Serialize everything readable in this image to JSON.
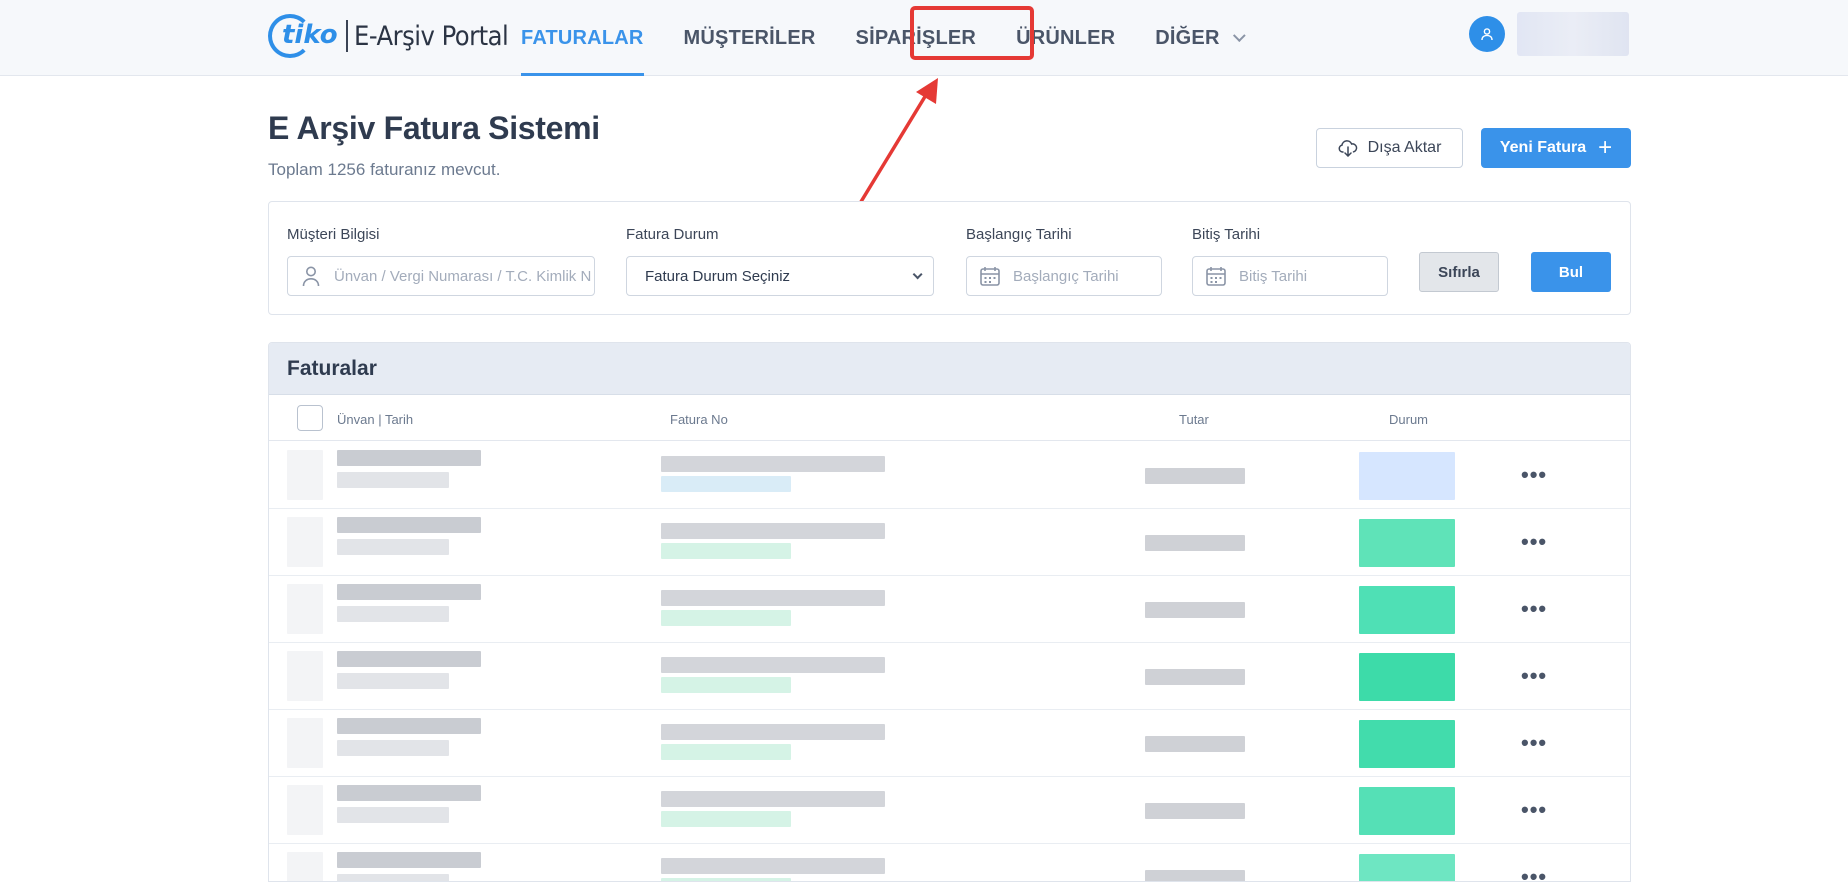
{
  "brand": {
    "logo_text": "tiko",
    "portal_name": "E-Arşiv Portal"
  },
  "nav": {
    "items": [
      {
        "label": "FATURALAR",
        "active": true
      },
      {
        "label": "MÜŞTERİLER",
        "active": false
      },
      {
        "label": "SİPARİŞLER",
        "active": false
      },
      {
        "label": "ÜRÜNLER",
        "active": false,
        "highlighted": true
      },
      {
        "label": "DİĞER",
        "active": false,
        "has_dropdown": true
      }
    ]
  },
  "header": {
    "title": "E Arşiv Fatura Sistemi",
    "subtitle": "Toplam 1256 faturanız mevcut.",
    "export_label": "Dışa Aktar",
    "new_invoice_label": "Yeni Fatura"
  },
  "filters": {
    "customer_label": "Müşteri Bilgisi",
    "customer_placeholder": "Ünvan / Vergi Numarası / T.C. Kimlik N",
    "status_label": "Fatura Durum",
    "status_value": "Fatura Durum Seçiniz",
    "start_label": "Başlangıç Tarihi",
    "start_placeholder": "Başlangıç Tarihi",
    "end_label": "Bitiş Tarihi",
    "end_placeholder": "Bitiş Tarihi",
    "reset_label": "Sıfırla",
    "find_label": "Bul"
  },
  "table": {
    "title": "Faturalar",
    "columns": {
      "title_date": "Ünvan | Tarih",
      "invoice_no": "Fatura No",
      "amount": "Tutar",
      "status": "Durum"
    },
    "rows": [
      {
        "status_color": "#d6e6ff",
        "menu": "•••"
      },
      {
        "status_color": "#5fe3b8",
        "menu": "•••"
      },
      {
        "status_color": "#4fe0b5",
        "menu": "•••"
      },
      {
        "status_color": "#3ddba9",
        "menu": "•••"
      },
      {
        "status_color": "#42dcac",
        "menu": "•••"
      },
      {
        "status_color": "#55e0b6",
        "menu": "•••"
      },
      {
        "status_color": "#6ee6c2",
        "menu": "•••"
      }
    ]
  },
  "colors": {
    "accent": "#3a93ea",
    "highlight": "#e53935"
  }
}
